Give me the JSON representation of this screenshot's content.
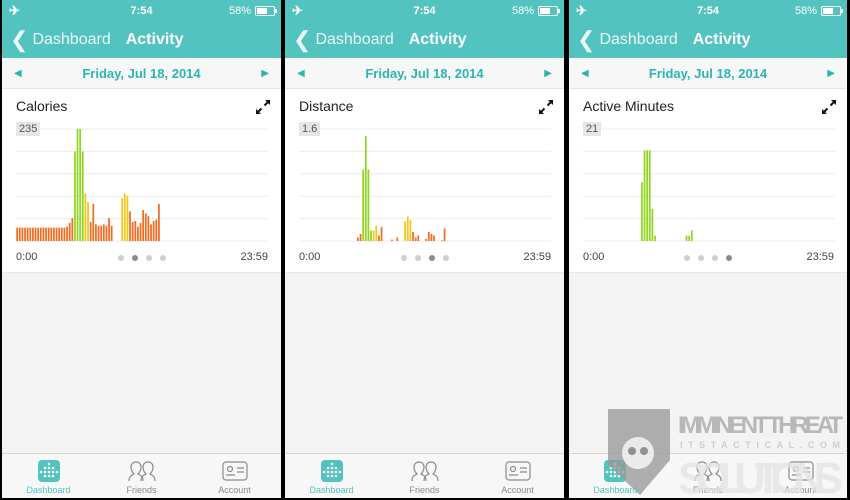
{
  "status_bar": {
    "time": "7:54",
    "battery": "58%",
    "battery_level": 0.58,
    "airplane_icon": "airplane-icon"
  },
  "nav": {
    "back_label": "Dashboard",
    "title": "Activity"
  },
  "date_bar": {
    "date": "Friday, Jul 18, 2014",
    "prev_icon": "triangle-left-icon",
    "next_icon": "triangle-right-icon"
  },
  "colors": {
    "teal": "#52c3bf",
    "green": "#8fd61c",
    "yellow": "#f5c518",
    "orange": "#f26a1b",
    "grid": "#ececec"
  },
  "tabbar": {
    "items": [
      {
        "label": "Dashboard",
        "icon": "dashboard-dots-icon",
        "active": true
      },
      {
        "label": "Friends",
        "icon": "friends-icon",
        "active": false
      },
      {
        "label": "Account",
        "icon": "account-card-icon",
        "active": false
      }
    ]
  },
  "panels": [
    {
      "card_title": "Calories",
      "max_label": "235",
      "x_start": "0:00",
      "x_end": "23:59",
      "page_dots": 4,
      "active_dot": 1
    },
    {
      "card_title": "Distance",
      "max_label": "1.6",
      "x_start": "0:00",
      "x_end": "23:59",
      "page_dots": 4,
      "active_dot": 2
    },
    {
      "card_title": "Active Minutes",
      "max_label": "21",
      "x_start": "0:00",
      "x_end": "23:59",
      "page_dots": 4,
      "active_dot": 3
    }
  ],
  "watermark": {
    "line1": "IMMINENT THREAT",
    "line2": "ITSTACTICAL.COM",
    "line3": "SOLUTIONS"
  },
  "chart_data": [
    {
      "type": "bar",
      "title": "Calories",
      "xlabel": "",
      "ylabel": "",
      "x_range": [
        "0:00",
        "23:59"
      ],
      "ylim": [
        0,
        235
      ],
      "grid": true,
      "bins": 96,
      "values": [
        28,
        28,
        28,
        28,
        28,
        28,
        28,
        28,
        28,
        28,
        28,
        28,
        28,
        28,
        28,
        28,
        28,
        28,
        28,
        30,
        38,
        48,
        188,
        235,
        235,
        188,
        100,
        82,
        40,
        78,
        35,
        32,
        32,
        35,
        32,
        48,
        32,
        0,
        0,
        0,
        90,
        100,
        95,
        62,
        40,
        42,
        30,
        38,
        65,
        58,
        52,
        35,
        42,
        45,
        78,
        0
      ],
      "levels": [
        "o",
        "o",
        "o",
        "o",
        "o",
        "o",
        "o",
        "o",
        "o",
        "o",
        "o",
        "o",
        "o",
        "o",
        "o",
        "o",
        "o",
        "o",
        "o",
        "o",
        "o",
        "o",
        "g",
        "g",
        "g",
        "g",
        "y",
        "y",
        "o",
        "o",
        "o",
        "o",
        "o",
        "o",
        "o",
        "o",
        "o",
        "o",
        "o",
        "o",
        "y",
        "y",
        "y",
        "o",
        "o",
        "o",
        "o",
        "o",
        "o",
        "o",
        "o",
        "o",
        "o",
        "o",
        "o",
        "o"
      ]
    },
    {
      "type": "bar",
      "title": "Distance",
      "xlabel": "",
      "ylabel": "",
      "x_range": [
        "0:00",
        "23:59"
      ],
      "ylim": [
        0,
        1.6
      ],
      "grid": true,
      "bins": 96,
      "values": [
        0,
        0,
        0,
        0,
        0,
        0,
        0,
        0,
        0,
        0,
        0,
        0,
        0,
        0,
        0,
        0,
        0,
        0,
        0,
        0,
        0,
        0,
        0.05,
        0.1,
        1.02,
        1.5,
        1.02,
        0.15,
        0.15,
        0.22,
        0.08,
        0.2,
        0,
        0,
        0,
        0.02,
        0,
        0.05,
        0,
        0,
        0.28,
        0.35,
        0.3,
        0.13,
        0.05,
        0.08,
        0,
        0,
        0.03,
        0.13,
        0.1,
        0.08,
        0,
        0,
        0.01,
        0.18
      ],
      "levels": [
        "o",
        "o",
        "o",
        "o",
        "o",
        "o",
        "o",
        "o",
        "o",
        "o",
        "o",
        "o",
        "o",
        "o",
        "o",
        "o",
        "o",
        "o",
        "o",
        "o",
        "o",
        "o",
        "o",
        "o",
        "g",
        "g",
        "g",
        "g",
        "y",
        "y",
        "o",
        "o",
        "o",
        "o",
        "o",
        "o",
        "o",
        "o",
        "o",
        "o",
        "y",
        "y",
        "y",
        "o",
        "o",
        "o",
        "o",
        "o",
        "o",
        "o",
        "o",
        "o",
        "o",
        "o",
        "o",
        "o"
      ]
    },
    {
      "type": "bar",
      "title": "Active Minutes",
      "xlabel": "",
      "ylabel": "",
      "x_range": [
        "0:00",
        "23:59"
      ],
      "ylim": [
        0,
        21
      ],
      "grid": true,
      "bins": 96,
      "values": [
        0,
        0,
        0,
        0,
        0,
        0,
        0,
        0,
        0,
        0,
        0,
        0,
        0,
        0,
        0,
        0,
        0,
        0,
        0,
        0,
        0,
        0,
        11,
        17,
        17,
        17,
        6,
        1,
        0,
        0,
        0,
        0,
        0,
        0,
        0,
        0,
        0,
        0,
        0,
        1,
        1,
        2,
        0,
        0,
        0,
        0,
        0,
        0,
        0,
        0,
        0,
        0,
        0,
        0,
        0,
        0
      ],
      "levels": [
        "g",
        "g",
        "g",
        "g",
        "g",
        "g",
        "g",
        "g",
        "g",
        "g",
        "g",
        "g",
        "g",
        "g",
        "g",
        "g",
        "g",
        "g",
        "g",
        "g",
        "g",
        "g",
        "g",
        "g",
        "g",
        "g",
        "g",
        "g",
        "g",
        "g",
        "g",
        "g",
        "g",
        "g",
        "g",
        "g",
        "g",
        "g",
        "g",
        "g",
        "g",
        "g",
        "g",
        "g",
        "g",
        "g",
        "g",
        "g",
        "g",
        "g",
        "g",
        "g",
        "g",
        "g",
        "g",
        "g"
      ]
    }
  ]
}
